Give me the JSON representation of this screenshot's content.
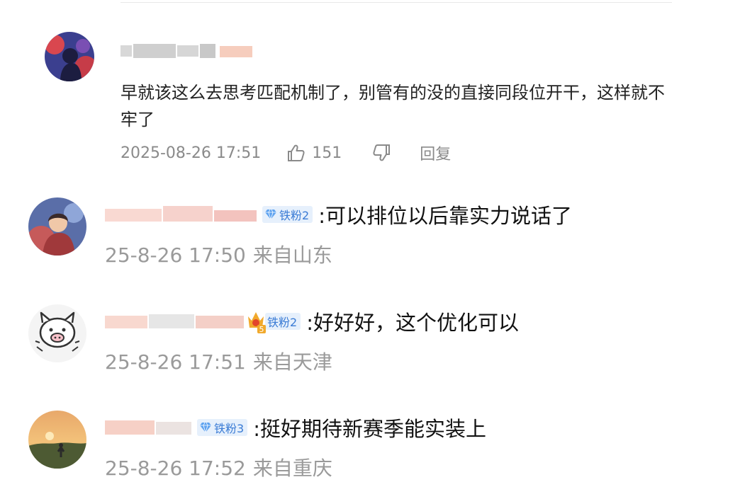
{
  "main_comment": {
    "text": "早就该这么去思考匹配机制了，别管有的没的直接同段位开干，这样就不牢了",
    "time": "2025-08-26 17:51",
    "likes": "151",
    "reply_label": "回复"
  },
  "replies": [
    {
      "badge": "铁粉2",
      "text": ":可以排位以后靠实力说话了",
      "time": "25-8-26 17:50",
      "location": "来自山东"
    },
    {
      "badge": "铁粉2",
      "crown_level": "5",
      "text": ":好好好，这个优化可以",
      "time": "25-8-26 17:51",
      "location": "来自天津"
    },
    {
      "badge": "铁粉3",
      "text": ":挺好期待新赛季能实装上",
      "time": "25-8-26 17:52",
      "location": "来自重庆"
    }
  ],
  "icons": {
    "like": "thumbs-up-icon",
    "dislike": "thumbs-down-icon",
    "badge": "diamond-icon",
    "crown": "crown-icon"
  },
  "colors": {
    "badge_text": "#3a7bd5",
    "badge_bg": "#e6f0fc",
    "meta": "#8a8a8a"
  }
}
